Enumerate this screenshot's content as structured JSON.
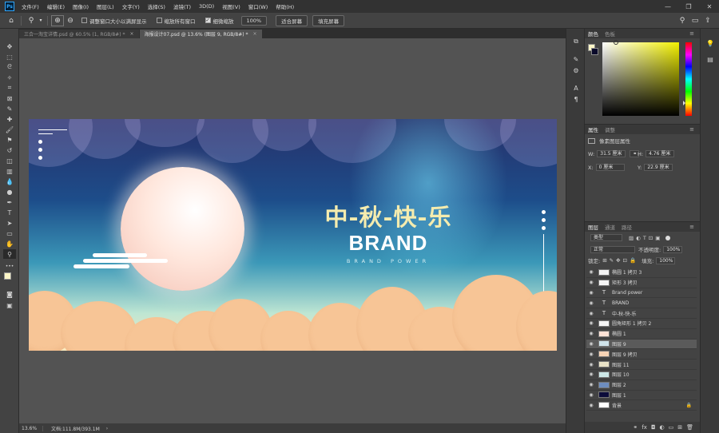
{
  "menubar": {
    "logo": "Ps",
    "items": [
      "文件(F)",
      "编辑(E)",
      "图像(I)",
      "图层(L)",
      "文字(Y)",
      "选择(S)",
      "滤镜(T)",
      "3D(D)",
      "视图(V)",
      "窗口(W)",
      "帮助(H)"
    ],
    "minimize": "—",
    "restore": "❐",
    "close": "✕"
  },
  "options": {
    "resize_windows": "调整窗口大小以满屏显示",
    "zoom_all": "缩放所有窗口",
    "scrubby_zoom": "细微缩放",
    "zoom_value": "100%",
    "fit_screen": "适合屏幕",
    "fill_screen": "填充屏幕"
  },
  "tabs": [
    {
      "label": "三合一淘宝详情.psd @ 60.5% (1, RGB/8#) *",
      "close": "×"
    },
    {
      "label": "海报设计07.psd @ 13.6% (图层 9, RGB/8#) *",
      "close": "×"
    }
  ],
  "artboard": {
    "title": "中-秋-快-乐",
    "brand": "BRAND",
    "brand_power": "BRAND POWER"
  },
  "status": {
    "zoom": "13.6%",
    "doc": "文档:111.8M/393.1M",
    "arrow": "›"
  },
  "color_panel": {
    "tab_color": "颜色",
    "tab_swatches": "色板",
    "menu": "≡"
  },
  "properties_panel": {
    "tab_properties": "属性",
    "tab_adjust": "调整",
    "menu": "≡",
    "type": "像素图层属性",
    "w_label": "W:",
    "w_value": "31.5 厘米",
    "h_label": "H:",
    "h_value": "4.76 厘米",
    "x_label": "X:",
    "x_value": "0 厘米",
    "y_label": "Y:",
    "y_value": "22.9 厘米"
  },
  "layers_panel": {
    "tab_layers": "图层",
    "tab_channels": "通道",
    "tab_paths": "路径",
    "menu": "≡",
    "filter": "类型",
    "blend_mode": "正常",
    "opacity_label": "不透明度:",
    "opacity": "100%",
    "lock_label": "锁定:",
    "fill_label": "填充:",
    "fill": "100%",
    "layers": [
      {
        "name": "椭圆 1 拷贝 3",
        "kind": "shape"
      },
      {
        "name": "矩形 3 拷贝",
        "kind": "shape"
      },
      {
        "name": "Brand power",
        "kind": "text"
      },
      {
        "name": "BRAND",
        "kind": "text"
      },
      {
        "name": "中-秋-快-乐",
        "kind": "text"
      },
      {
        "name": "圆角矩形 1 拷贝 2",
        "kind": "shape"
      },
      {
        "name": "椭圆 1",
        "kind": "shape"
      },
      {
        "name": "图层 9",
        "kind": "pixel",
        "selected": true
      },
      {
        "name": "图层 9 拷贝",
        "kind": "pixel"
      },
      {
        "name": "图层 11",
        "kind": "pixel"
      },
      {
        "name": "图层 10",
        "kind": "pixel"
      },
      {
        "name": "图层 2",
        "kind": "pixel"
      },
      {
        "name": "图层 1",
        "kind": "pixel"
      },
      {
        "name": "背景",
        "kind": "bg"
      }
    ]
  },
  "colors": {
    "fg": "#fbf5c6",
    "bg": "#0a0a2a",
    "cloud": "#f7c596",
    "title": "#f5ecae"
  }
}
